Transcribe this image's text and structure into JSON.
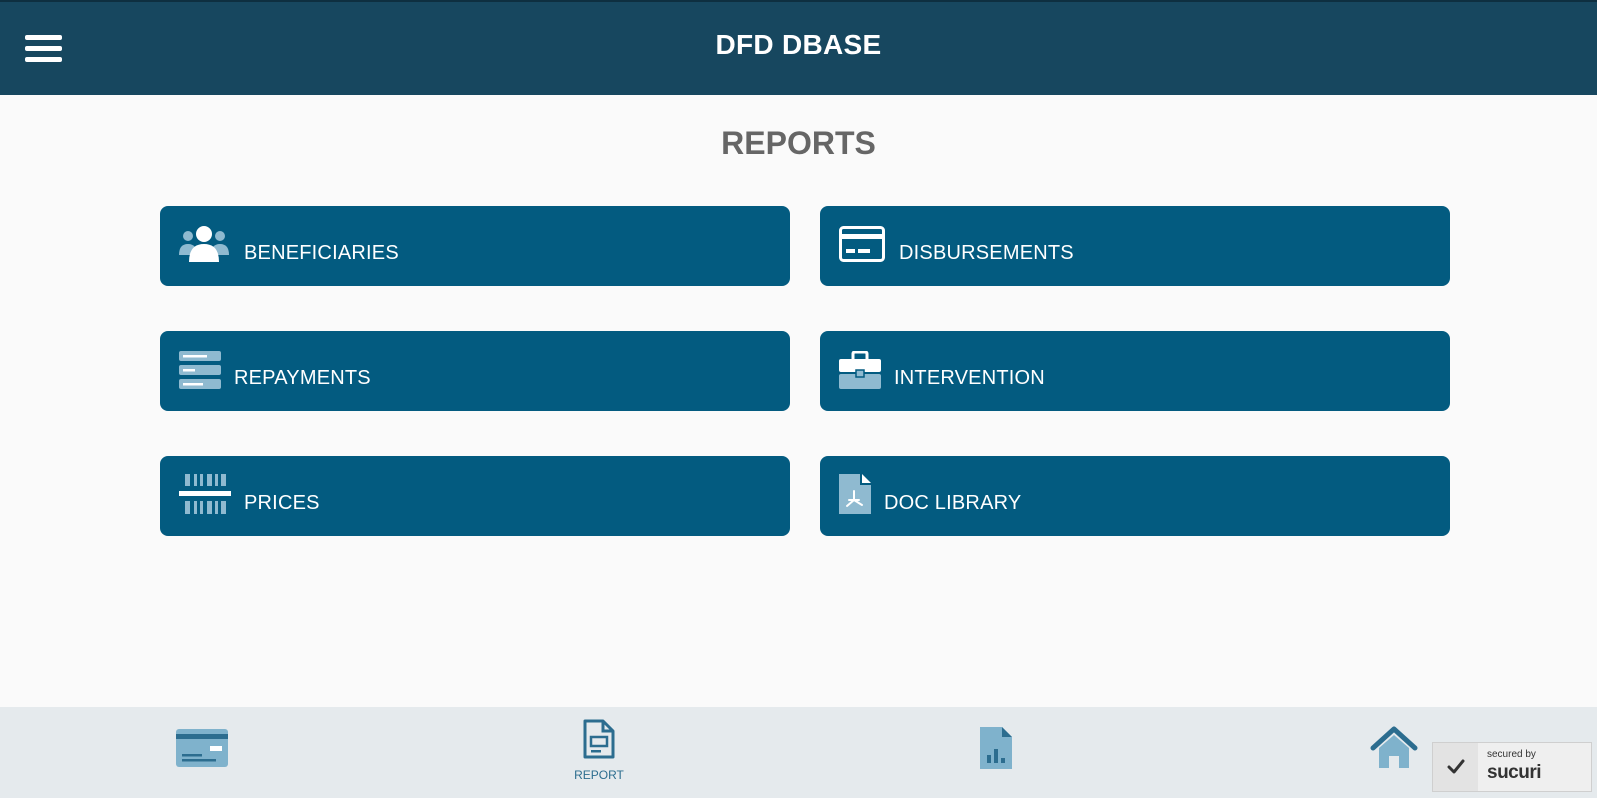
{
  "header": {
    "title": "DFD DBASE",
    "menu_icon": "hamburger-menu-icon"
  },
  "page": {
    "title": "REPORTS"
  },
  "tiles": [
    {
      "label": "BENEFICIARIES",
      "icon": "users-icon"
    },
    {
      "label": "DISBURSEMENTS",
      "icon": "credit-card-icon"
    },
    {
      "label": "REPAYMENTS",
      "icon": "list-rows-icon"
    },
    {
      "label": "INTERVENTION",
      "icon": "briefcase-icon"
    },
    {
      "label": "PRICES",
      "icon": "barcode-icon"
    },
    {
      "label": "DOC LIBRARY",
      "icon": "pdf-file-icon"
    }
  ],
  "footer": {
    "items": [
      {
        "label": "",
        "icon": "card-icon"
      },
      {
        "label": "REPORT",
        "icon": "report-document-icon"
      },
      {
        "label": "",
        "icon": "chart-file-icon"
      },
      {
        "label": "",
        "icon": "home-icon"
      }
    ]
  },
  "badge": {
    "small_text": "secured by",
    "brand_text": "sucuri"
  },
  "colors": {
    "header_bg": "#17475f",
    "tile_bg": "#035b80",
    "footer_bg": "#e5eaed",
    "accent_light": "#7fb2cc"
  }
}
